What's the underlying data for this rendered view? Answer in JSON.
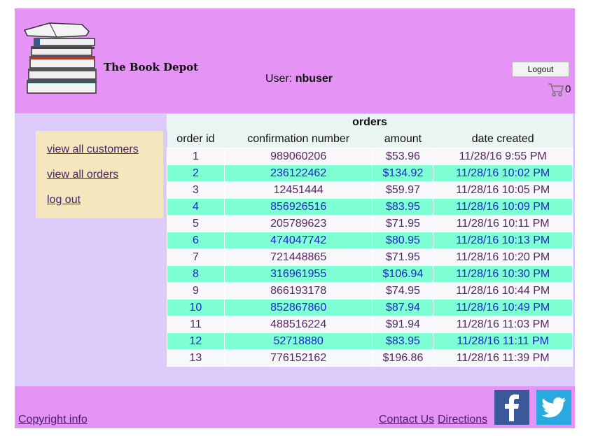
{
  "header": {
    "site_title": "The Book Depot",
    "user_label": "User:",
    "username": "nbuser",
    "logout_label": "Logout",
    "cart_count": "0"
  },
  "sidebar": {
    "links": [
      {
        "label": "view all customers"
      },
      {
        "label": "view all orders"
      },
      {
        "label": "log out"
      }
    ]
  },
  "orders": {
    "caption": "orders",
    "columns": [
      "order id",
      "confirmation number",
      "amount",
      "date created"
    ],
    "rows": [
      [
        "1",
        "989060206",
        "$53.96",
        "11/28/16 9:55 PM"
      ],
      [
        "2",
        "236122462",
        "$134.92",
        "11/28/16 10:02 PM"
      ],
      [
        "3",
        "12451444",
        "$59.97",
        "11/28/16 10:05 PM"
      ],
      [
        "4",
        "856926516",
        "$83.95",
        "11/28/16 10:09 PM"
      ],
      [
        "5",
        "205789623",
        "$71.95",
        "11/28/16 10:11 PM"
      ],
      [
        "6",
        "474047742",
        "$80.95",
        "11/28/16 10:13 PM"
      ],
      [
        "7",
        "721448865",
        "$71.95",
        "11/28/16 10:20 PM"
      ],
      [
        "8",
        "316961955",
        "$106.94",
        "11/28/16 10:30 PM"
      ],
      [
        "9",
        "866193178",
        "$74.95",
        "11/28/16 10:44 PM"
      ],
      [
        "10",
        "852867860",
        "$87.94",
        "11/28/16 10:49 PM"
      ],
      [
        "11",
        "488516224",
        "$91.94",
        "11/28/16 11:03 PM"
      ],
      [
        "12",
        "52718880",
        "$83.95",
        "11/28/16 11:11 PM"
      ],
      [
        "13",
        "776152162",
        "$196.86",
        "11/28/16 11:39 PM"
      ]
    ]
  },
  "footer": {
    "copyright_label": "Copyright info",
    "contact_label": "Contact Us",
    "directions_label": "Directions",
    "social": [
      {
        "icon": "facebook-icon",
        "color": "#3b5998"
      },
      {
        "icon": "twitter-icon",
        "color": "#2aa9e0"
      }
    ]
  },
  "colors": {
    "header_bg": "#e593f5",
    "content_bg": "#dccbfa",
    "sidebar_bg": "#f5e7bd",
    "row_alt_bg": "#7fffd4"
  }
}
